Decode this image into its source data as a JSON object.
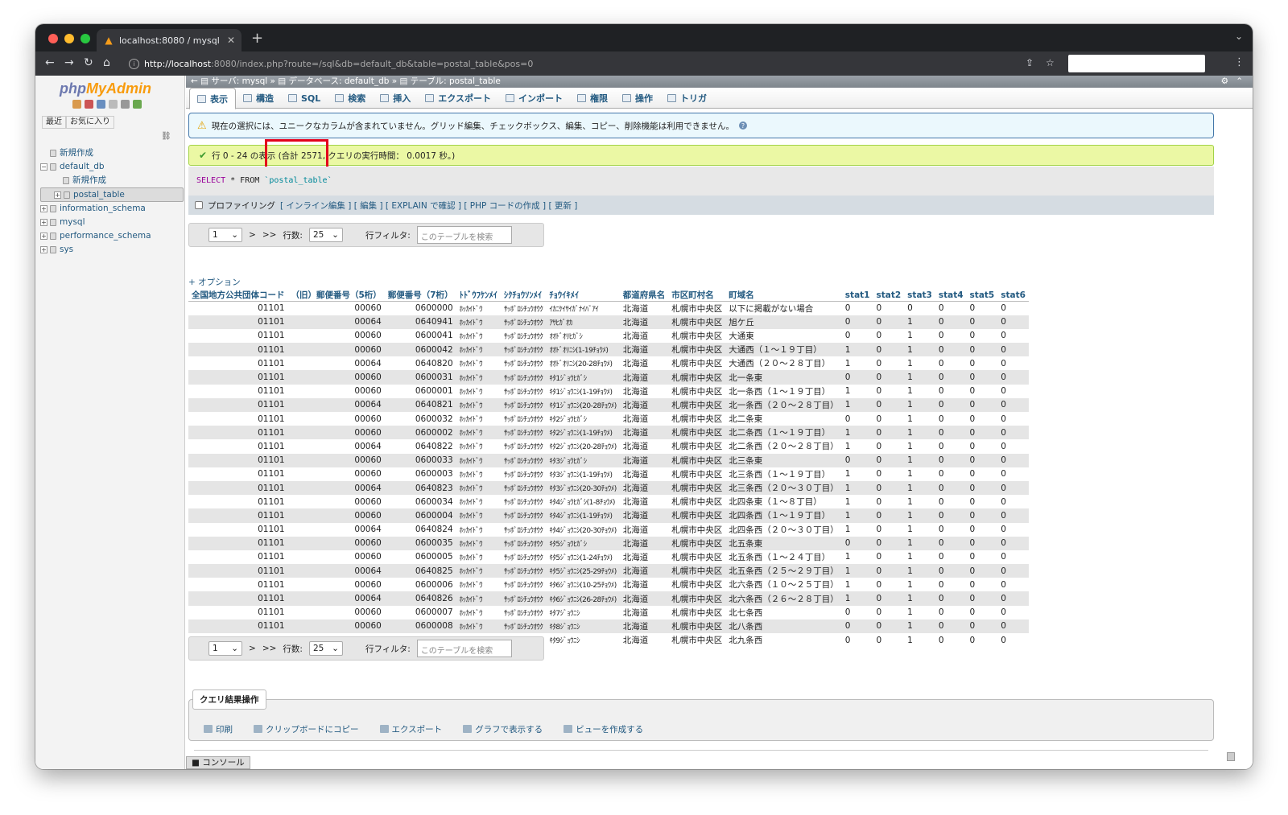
{
  "browser": {
    "tab_title": "localhost:8080 / mysql / defau",
    "url_host": "http://localhost",
    "url_rest": ":8080/index.php?route=/sql&db=default_db&table=postal_table&pos=0"
  },
  "sidebar": {
    "logo_php": "php",
    "logo_myadmin": "MyAdmin",
    "btn_recent": "最近",
    "btn_favorites": "お気に入り",
    "tree": [
      {
        "label": "新規作成",
        "level": 0
      },
      {
        "label": "default_db",
        "level": 0
      },
      {
        "label": "新規作成",
        "level": 1
      },
      {
        "label": "postal_table",
        "level": 1
      },
      {
        "label": "information_schema",
        "level": 0
      },
      {
        "label": "mysql",
        "level": 0
      },
      {
        "label": "performance_schema",
        "level": 0
      },
      {
        "label": "sys",
        "level": 0
      }
    ]
  },
  "breadcrumb": {
    "server": "サーバ: mysql",
    "database": "データベース: default_db",
    "table": "テーブル: postal_table"
  },
  "tabs": [
    "表示",
    "構造",
    "SQL",
    "検索",
    "挿入",
    "エクスポート",
    "インポート",
    "権限",
    "操作",
    "トリガ"
  ],
  "notice": "現在の選択には、ユニークなカラムが含まれていません。グリッド編集、チェックボックス、編集、コピー、削除機能は利用できません。",
  "success": "行 0 - 24 の表示 (合計 2571, クエリの実行時間： 0.0017 秒。)",
  "sql": {
    "select": "SELECT",
    "rest": " * FROM ",
    "table": "`postal_table`"
  },
  "profiling": {
    "label": "プロファイリング",
    "links": "[ インライン編集 ] [ 編集 ] [ EXPLAIN で確認 ] [ PHP コードの作成 ] [ 更新 ]"
  },
  "pager": {
    "page": "1",
    "next": ">",
    "last": ">>",
    "rows_label": "行数:",
    "rows_value": "25",
    "filter_label": "行フィルタ:",
    "filter_placeholder": "このテーブルを検索"
  },
  "options_link": "+ オプション",
  "table": {
    "headers": [
      "全国地方公共団体コード",
      "（旧）郵便番号（5桁）",
      "郵便番号（7桁）",
      "ﾄﾄﾞｳﾌｹﾝﾒｲ",
      "ｼｸﾁｮｳｿﾝﾒｲ",
      "ﾁｮｳｲｷﾒｲ",
      "都道府県名",
      "市区町村名",
      "町域名",
      "stat1",
      "stat2",
      "stat3",
      "stat4",
      "stat5",
      "stat6"
    ],
    "rows": [
      [
        "01101",
        "00060",
        "0600000",
        "ﾎｯｶｲﾄﾞｳ",
        "ｻｯﾎﾟﾛｼﾁｭｳｵｳｸ",
        "ｲｶﾆｹｲｻｲｶﾞﾅｲﾊﾞｱｲ",
        "北海道",
        "札幌市中央区",
        "以下に掲載がない場合",
        "0",
        "0",
        "0",
        "0",
        "0",
        "0"
      ],
      [
        "01101",
        "00064",
        "0640941",
        "ﾎｯｶｲﾄﾞｳ",
        "ｻｯﾎﾟﾛｼﾁｭｳｵｳｸ",
        "ｱｻﾋｶﾞｵｶ",
        "北海道",
        "札幌市中央区",
        "旭ケ丘",
        "0",
        "0",
        "1",
        "0",
        "0",
        "0"
      ],
      [
        "01101",
        "00060",
        "0600041",
        "ﾎｯｶｲﾄﾞｳ",
        "ｻｯﾎﾟﾛｼﾁｭｳｵｳｸ",
        "ｵｵﾄﾞｵﾘﾋｶﾞｼ",
        "北海道",
        "札幌市中央区",
        "大通東",
        "0",
        "0",
        "1",
        "0",
        "0",
        "0"
      ],
      [
        "01101",
        "00060",
        "0600042",
        "ﾎｯｶｲﾄﾞｳ",
        "ｻｯﾎﾟﾛｼﾁｭｳｵｳｸ",
        "ｵｵﾄﾞｵﾘﾆｼ(1-19ﾁｮｳﾒ)",
        "北海道",
        "札幌市中央区",
        "大通西（１〜１９丁目）",
        "1",
        "0",
        "1",
        "0",
        "0",
        "0"
      ],
      [
        "01101",
        "00064",
        "0640820",
        "ﾎｯｶｲﾄﾞｳ",
        "ｻｯﾎﾟﾛｼﾁｭｳｵｳｸ",
        "ｵｵﾄﾞｵﾘﾆｼ(20-28ﾁｮｳﾒ)",
        "北海道",
        "札幌市中央区",
        "大通西（２０〜２８丁目）",
        "1",
        "0",
        "1",
        "0",
        "0",
        "0"
      ],
      [
        "01101",
        "00060",
        "0600031",
        "ﾎｯｶｲﾄﾞｳ",
        "ｻｯﾎﾟﾛｼﾁｭｳｵｳｸ",
        "ｷﾀ1ｼﾞｮｳﾋｶﾞｼ",
        "北海道",
        "札幌市中央区",
        "北一条東",
        "0",
        "0",
        "1",
        "0",
        "0",
        "0"
      ],
      [
        "01101",
        "00060",
        "0600001",
        "ﾎｯｶｲﾄﾞｳ",
        "ｻｯﾎﾟﾛｼﾁｭｳｵｳｸ",
        "ｷﾀ1ｼﾞｮｳﾆｼ(1-19ﾁｮｳﾒ)",
        "北海道",
        "札幌市中央区",
        "北一条西（１〜１９丁目）",
        "1",
        "0",
        "1",
        "0",
        "0",
        "0"
      ],
      [
        "01101",
        "00064",
        "0640821",
        "ﾎｯｶｲﾄﾞｳ",
        "ｻｯﾎﾟﾛｼﾁｭｳｵｳｸ",
        "ｷﾀ1ｼﾞｮｳﾆｼ(20-28ﾁｮｳﾒ)",
        "北海道",
        "札幌市中央区",
        "北一条西（２０〜２８丁目）",
        "1",
        "0",
        "1",
        "0",
        "0",
        "0"
      ],
      [
        "01101",
        "00060",
        "0600032",
        "ﾎｯｶｲﾄﾞｳ",
        "ｻｯﾎﾟﾛｼﾁｭｳｵｳｸ",
        "ｷﾀ2ｼﾞｮｳﾋｶﾞｼ",
        "北海道",
        "札幌市中央区",
        "北二条東",
        "0",
        "0",
        "1",
        "0",
        "0",
        "0"
      ],
      [
        "01101",
        "00060",
        "0600002",
        "ﾎｯｶｲﾄﾞｳ",
        "ｻｯﾎﾟﾛｼﾁｭｳｵｳｸ",
        "ｷﾀ2ｼﾞｮｳﾆｼ(1-19ﾁｮｳﾒ)",
        "北海道",
        "札幌市中央区",
        "北二条西（１〜１９丁目）",
        "1",
        "0",
        "1",
        "0",
        "0",
        "0"
      ],
      [
        "01101",
        "00064",
        "0640822",
        "ﾎｯｶｲﾄﾞｳ",
        "ｻｯﾎﾟﾛｼﾁｭｳｵｳｸ",
        "ｷﾀ2ｼﾞｮｳﾆｼ(20-28ﾁｮｳﾒ)",
        "北海道",
        "札幌市中央区",
        "北二条西（２０〜２８丁目）",
        "1",
        "0",
        "1",
        "0",
        "0",
        "0"
      ],
      [
        "01101",
        "00060",
        "0600033",
        "ﾎｯｶｲﾄﾞｳ",
        "ｻｯﾎﾟﾛｼﾁｭｳｵｳｸ",
        "ｷﾀ3ｼﾞｮｳﾋｶﾞｼ",
        "北海道",
        "札幌市中央区",
        "北三条東",
        "0",
        "0",
        "1",
        "0",
        "0",
        "0"
      ],
      [
        "01101",
        "00060",
        "0600003",
        "ﾎｯｶｲﾄﾞｳ",
        "ｻｯﾎﾟﾛｼﾁｭｳｵｳｸ",
        "ｷﾀ3ｼﾞｮｳﾆｼ(1-19ﾁｮｳﾒ)",
        "北海道",
        "札幌市中央区",
        "北三条西（１〜１９丁目）",
        "1",
        "0",
        "1",
        "0",
        "0",
        "0"
      ],
      [
        "01101",
        "00064",
        "0640823",
        "ﾎｯｶｲﾄﾞｳ",
        "ｻｯﾎﾟﾛｼﾁｭｳｵｳｸ",
        "ｷﾀ3ｼﾞｮｳﾆｼ(20-30ﾁｮｳﾒ)",
        "北海道",
        "札幌市中央区",
        "北三条西（２０〜３０丁目）",
        "1",
        "0",
        "1",
        "0",
        "0",
        "0"
      ],
      [
        "01101",
        "00060",
        "0600034",
        "ﾎｯｶｲﾄﾞｳ",
        "ｻｯﾎﾟﾛｼﾁｭｳｵｳｸ",
        "ｷﾀ4ｼﾞｮｳﾋｶﾞｼ(1-8ﾁｮｳﾒ)",
        "北海道",
        "札幌市中央区",
        "北四条東（１〜８丁目）",
        "1",
        "0",
        "1",
        "0",
        "0",
        "0"
      ],
      [
        "01101",
        "00060",
        "0600004",
        "ﾎｯｶｲﾄﾞｳ",
        "ｻｯﾎﾟﾛｼﾁｭｳｵｳｸ",
        "ｷﾀ4ｼﾞｮｳﾆｼ(1-19ﾁｮｳﾒ)",
        "北海道",
        "札幌市中央区",
        "北四条西（１〜１９丁目）",
        "1",
        "0",
        "1",
        "0",
        "0",
        "0"
      ],
      [
        "01101",
        "00064",
        "0640824",
        "ﾎｯｶｲﾄﾞｳ",
        "ｻｯﾎﾟﾛｼﾁｭｳｵｳｸ",
        "ｷﾀ4ｼﾞｮｳﾆｼ(20-30ﾁｮｳﾒ)",
        "北海道",
        "札幌市中央区",
        "北四条西（２０〜３０丁目）",
        "1",
        "0",
        "1",
        "0",
        "0",
        "0"
      ],
      [
        "01101",
        "00060",
        "0600035",
        "ﾎｯｶｲﾄﾞｳ",
        "ｻｯﾎﾟﾛｼﾁｭｳｵｳｸ",
        "ｷﾀ5ｼﾞｮｳﾋｶﾞｼ",
        "北海道",
        "札幌市中央区",
        "北五条東",
        "0",
        "0",
        "1",
        "0",
        "0",
        "0"
      ],
      [
        "01101",
        "00060",
        "0600005",
        "ﾎｯｶｲﾄﾞｳ",
        "ｻｯﾎﾟﾛｼﾁｭｳｵｳｸ",
        "ｷﾀ5ｼﾞｮｳﾆｼ(1-24ﾁｮｳﾒ)",
        "北海道",
        "札幌市中央区",
        "北五条西（１〜２４丁目）",
        "1",
        "0",
        "1",
        "0",
        "0",
        "0"
      ],
      [
        "01101",
        "00064",
        "0640825",
        "ﾎｯｶｲﾄﾞｳ",
        "ｻｯﾎﾟﾛｼﾁｭｳｵｳｸ",
        "ｷﾀ5ｼﾞｮｳﾆｼ(25-29ﾁｮｳﾒ)",
        "北海道",
        "札幌市中央区",
        "北五条西（２５〜２９丁目）",
        "1",
        "0",
        "1",
        "0",
        "0",
        "0"
      ],
      [
        "01101",
        "00060",
        "0600006",
        "ﾎｯｶｲﾄﾞｳ",
        "ｻｯﾎﾟﾛｼﾁｭｳｵｳｸ",
        "ｷﾀ6ｼﾞｮｳﾆｼ(10-25ﾁｮｳﾒ)",
        "北海道",
        "札幌市中央区",
        "北六条西（１０〜２５丁目）",
        "1",
        "0",
        "1",
        "0",
        "0",
        "0"
      ],
      [
        "01101",
        "00064",
        "0640826",
        "ﾎｯｶｲﾄﾞｳ",
        "ｻｯﾎﾟﾛｼﾁｭｳｵｳｸ",
        "ｷﾀ6ｼﾞｮｳﾆｼ(26-28ﾁｮｳﾒ)",
        "北海道",
        "札幌市中央区",
        "北六条西（２６〜２８丁目）",
        "1",
        "0",
        "1",
        "0",
        "0",
        "0"
      ],
      [
        "01101",
        "00060",
        "0600007",
        "ﾎｯｶｲﾄﾞｳ",
        "ｻｯﾎﾟﾛｼﾁｭｳｵｳｸ",
        "ｷﾀ7ｼﾞｮｳﾆｼ",
        "北海道",
        "札幌市中央区",
        "北七条西",
        "0",
        "0",
        "1",
        "0",
        "0",
        "0"
      ],
      [
        "01101",
        "00060",
        "0600008",
        "ﾎｯｶｲﾄﾞｳ",
        "ｻｯﾎﾟﾛｼﾁｭｳｵｳｸ",
        "ｷﾀ8ｼﾞｮｳﾆｼ",
        "北海道",
        "札幌市中央区",
        "北八条西",
        "0",
        "0",
        "1",
        "0",
        "0",
        "0"
      ],
      [
        "01101",
        "00060",
        "0600009",
        "ﾎｯｶｲﾄﾞｳ",
        "ｻｯﾎﾟﾛｼﾁｭｳｵｳｸ",
        "ｷﾀ9ｼﾞｮｳﾆｼ",
        "北海道",
        "札幌市中央区",
        "北九条西",
        "0",
        "0",
        "1",
        "0",
        "0",
        "0"
      ]
    ]
  },
  "query_ops": {
    "legend": "クエリ結果操作",
    "items": [
      "印刷",
      "クリップボードにコピー",
      "エクスポート",
      "グラフで表示する",
      "ビューを作成する"
    ]
  },
  "console_label": "コンソール",
  "colors": {
    "accent": "#235a81",
    "success_bg": "#ebf8a4",
    "highlight": "#e3001b"
  }
}
